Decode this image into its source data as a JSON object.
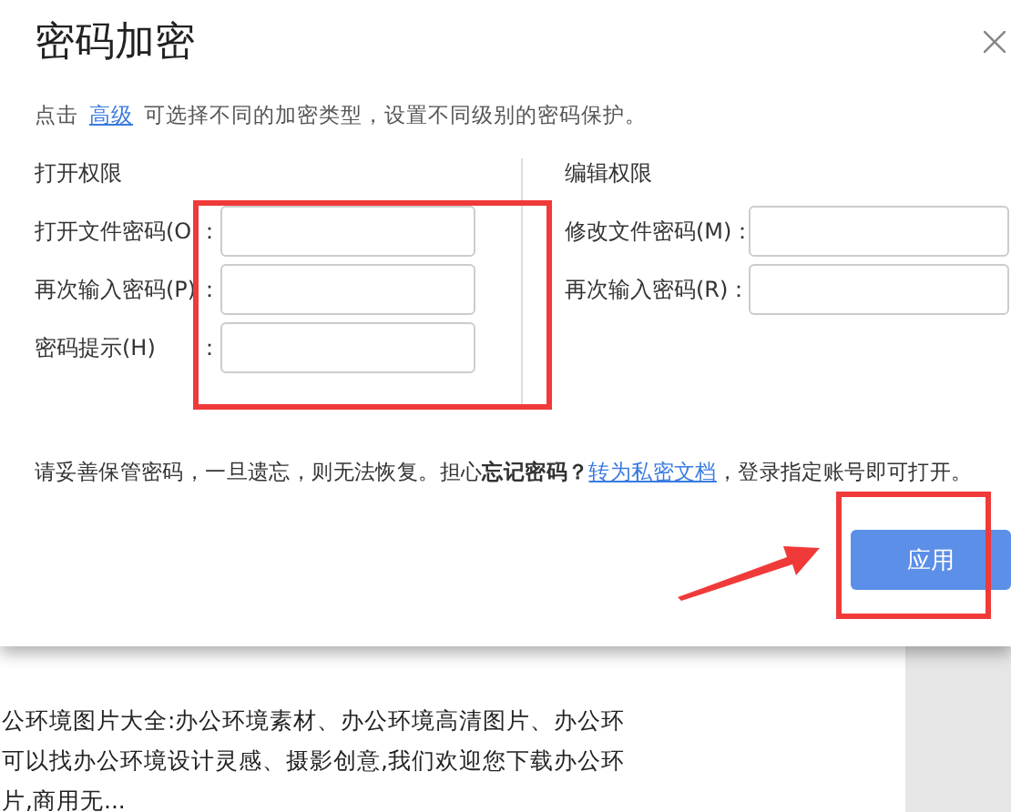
{
  "dialog": {
    "title": "密码加密",
    "description": {
      "before": "点击",
      "link": "高级",
      "after": "可选择不同的加密类型，设置不同级别的密码保护。"
    },
    "sections": [
      {
        "heading": "打开权限",
        "fields": [
          {
            "label": "打开文件密码(O",
            "colon": "："
          },
          {
            "label": "再次输入密码(P)",
            "colon": "："
          },
          {
            "label": "密码提示(H)",
            "colon": "："
          }
        ]
      },
      {
        "heading": "编辑权限",
        "fields": [
          {
            "label": "修改文件密码(M)",
            "colon": "："
          },
          {
            "label": "再次输入密码(R)",
            "colon": "："
          }
        ]
      }
    ],
    "notice": {
      "text": "请妥善保管密码，一旦遗忘，则无法恢复。担心**忘记密码？**",
      "link": "转为私密文档",
      "after": "，登录指定账号即可打开。"
    },
    "buttons": [
      "应用"
    ]
  },
  "document": {
    "lines": [
      "公环境图片大全:办公环境素材、办公环境高清图片、办公环",
      "可以找办公环境设计灵感、摄影创意,我们欢迎您下载办公环",
      "片,商用无..."
    ]
  }
}
